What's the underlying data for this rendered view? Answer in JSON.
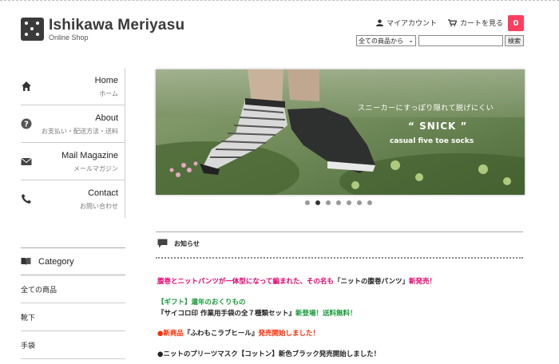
{
  "header": {
    "logo_title": "Ishikawa Meriyasu",
    "logo_subtitle": "Online Shop",
    "account_label": "マイアカウント",
    "cart_label": "カートを見る",
    "cart_count": "0"
  },
  "search": {
    "select_value": "全ての商品から",
    "button_label": "検索"
  },
  "nav": {
    "items": [
      {
        "en": "Home",
        "jp": "ホーム",
        "icon": "home-icon"
      },
      {
        "en": "About",
        "jp": "お支払い・配送方法・送料",
        "icon": "question-icon"
      },
      {
        "en": "Mail Magazine",
        "jp": "メールマガジン",
        "icon": "mail-icon"
      },
      {
        "en": "Contact",
        "jp": "お問い合わせ",
        "icon": "phone-icon"
      }
    ]
  },
  "category": {
    "title": "Category",
    "items": [
      "全ての商品",
      "靴下",
      "手袋"
    ]
  },
  "banner": {
    "line1": "スニーカーにすっぽり隠れて脱げにくい",
    "line2": "“ SNICK ”",
    "line3": "casual five toe socks",
    "slide_count": 7,
    "active_slide": 2
  },
  "news": {
    "title": "お知らせ",
    "items": [
      {
        "text": "腹巻とニットパンツが一体型になって編まれた、その名も",
        "text2": "「ニットの腹巻パンツ」",
        "text3": "新発売！"
      },
      {
        "text": "【ギフト】還年のおくりもの"
      },
      {
        "text": "『サイコロ印 作業用手袋の全７種類セット』",
        "text2": "新登場！送料無料！"
      },
      {
        "text": "●新商品",
        "text2": "『ふわもこラブヒール』",
        "text3": "発売開始しました！"
      },
      {
        "text": "●ニットのプリーツマスク【コットン】新色ブラック発売開始しました！"
      }
    ]
  },
  "colors": {
    "accent_badge": "#ff3d5e",
    "news_pink": "#e5006e",
    "news_green": "#179a38",
    "news_red": "#ff2a00"
  }
}
